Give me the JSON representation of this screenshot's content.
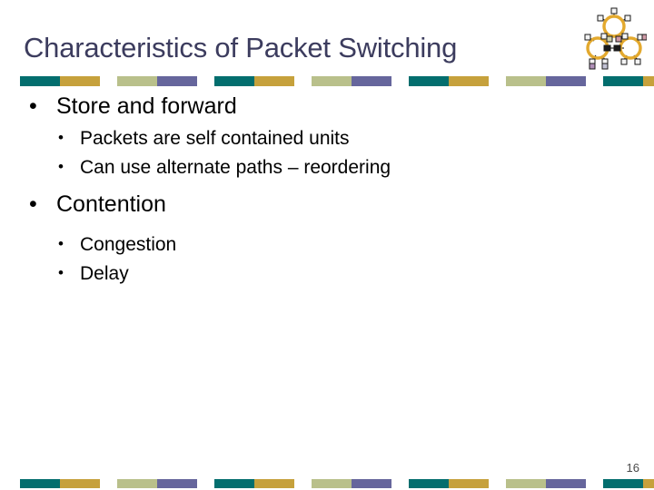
{
  "slide": {
    "title": "Characteristics of Packet Switching",
    "slide_number": "16",
    "bullets": [
      {
        "level": 1,
        "marker": "•",
        "text": "Store and forward"
      },
      {
        "level": 2,
        "marker": "•",
        "text": "Packets are self contained units"
      },
      {
        "level": 2,
        "marker": "•",
        "text": "Can use alternate paths – reordering"
      },
      {
        "level": 1,
        "marker": "•",
        "text": "Contention"
      },
      {
        "level": 2,
        "marker": "•",
        "text": "Congestion"
      },
      {
        "level": 2,
        "marker": "•",
        "text": "Delay"
      }
    ],
    "decoration": {
      "logo_name": "network-topology-icon",
      "ring_color": "#e3a92e",
      "node_color": "#f2f2f2",
      "node_border": "#1a1a1a",
      "link_color": "#1a1a1a"
    },
    "theme_colors": {
      "title": "#3c3c5e",
      "body_text": "#000000",
      "background": "#ffffff",
      "bar_teal": "#036e6e",
      "bar_gold": "#c6a13c",
      "bar_sage": "#b9c08b",
      "bar_slate": "#66669c",
      "slide_number": "#4a4a4a"
    },
    "bar_pattern": [
      "teal",
      "gold",
      "gap",
      "sage",
      "slate",
      "gap"
    ],
    "bar_repeats": 4
  }
}
